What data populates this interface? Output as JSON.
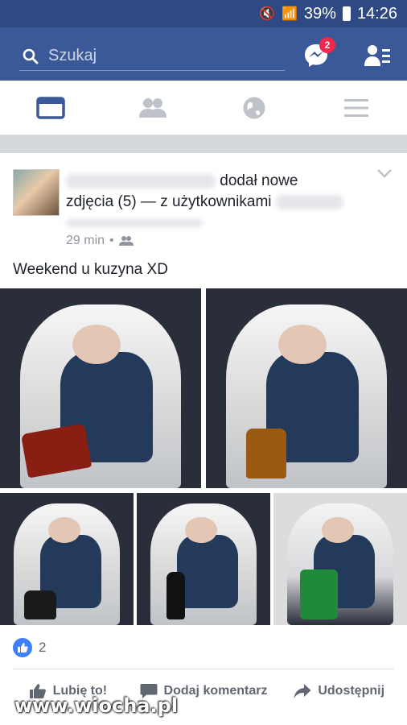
{
  "status_bar": {
    "battery": "39%",
    "time": "14:26"
  },
  "search": {
    "placeholder": "Szukaj"
  },
  "messenger": {
    "badge_count": "2"
  },
  "tabs": [
    {
      "name": "news-feed",
      "icon": "news-feed-icon",
      "active": true
    },
    {
      "name": "friends",
      "icon": "friends-icon",
      "active": false
    },
    {
      "name": "notifications",
      "icon": "globe-icon",
      "active": false
    },
    {
      "name": "menu",
      "icon": "hamburger-icon",
      "active": false
    }
  ],
  "post": {
    "action_text_1": "dodał nowe",
    "action_text_2": "zdjęcia (5) — z użytkownikami",
    "time": "29 min",
    "caption": "Weekend u kuzyna XD",
    "like_count": "2"
  },
  "actions": {
    "like": "Lubię to!",
    "comment": "Dodaj komentarz",
    "share": "Udostępnij"
  },
  "watermark": "www.wiocha.pl",
  "colors": {
    "brand": "#3b5998",
    "status_bar": "#2f4a82",
    "like_blue": "#4080ff",
    "badge_red": "#f02849"
  }
}
